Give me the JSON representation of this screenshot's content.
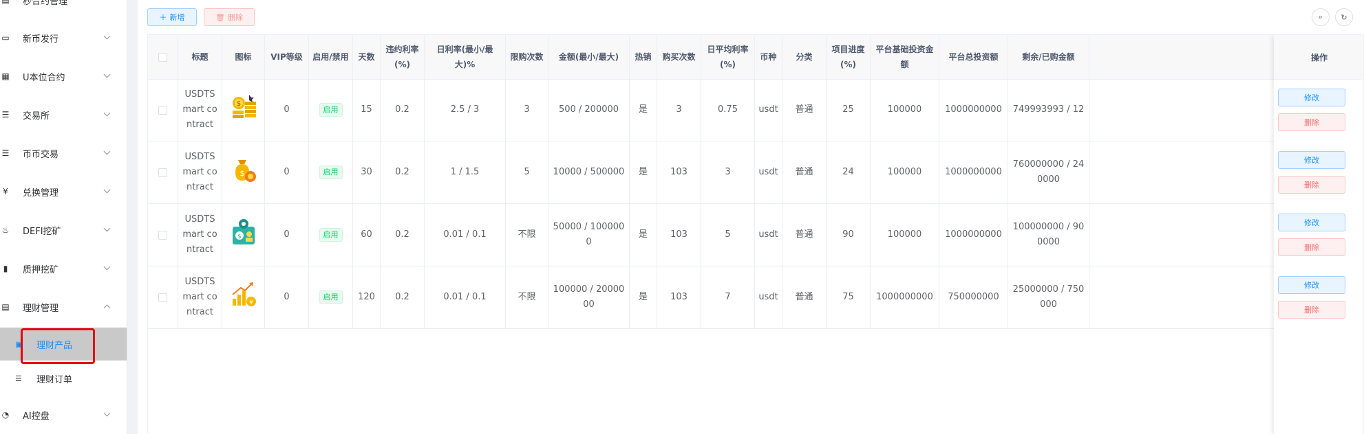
{
  "sidebar": {
    "items": [
      {
        "label": "秒合约管理",
        "icon": "box-icon",
        "glyph": "▤"
      },
      {
        "label": "新币发行",
        "icon": "card-icon",
        "glyph": "▭"
      },
      {
        "label": "U本位合约",
        "icon": "grid-icon",
        "glyph": "▦"
      },
      {
        "label": "交易所",
        "icon": "list-icon",
        "glyph": "☰"
      },
      {
        "label": "币币交易",
        "icon": "list-icon",
        "glyph": "☰"
      },
      {
        "label": "兑换管理",
        "icon": "yen-icon",
        "glyph": "¥"
      },
      {
        "label": "DEFI挖矿",
        "icon": "tool-icon",
        "glyph": "♨"
      },
      {
        "label": "质押挖矿",
        "icon": "bar-chart-icon",
        "glyph": "▮"
      },
      {
        "label": "理财管理",
        "icon": "document-icon",
        "glyph": "▤"
      }
    ],
    "sub_items": [
      {
        "label": "理财产品",
        "icon": "product-icon",
        "glyph": "▣"
      },
      {
        "label": "理财订单",
        "icon": "list-icon",
        "glyph": "☰"
      }
    ],
    "last_item": {
      "label": "AI控盘",
      "icon": "robot-icon",
      "glyph": "◔"
    }
  },
  "toolbar": {
    "add_label": "新增",
    "delete_label": "删除",
    "search_icon": "search-icon",
    "refresh_icon": "refresh-icon"
  },
  "table": {
    "headers": [
      "标题",
      "图标",
      "VIP等级",
      "启用/禁用",
      "天数",
      "违约利率(%)",
      "日利率(最小/最大)%",
      "限购次数",
      "金额(最小/最大)",
      "热销",
      "购买次数",
      "日平均利率(%)",
      "币种",
      "分类",
      "项目进度(%)",
      "平台基础投资金额",
      "平台总投资额",
      "剩余/已购金额"
    ],
    "op_header": "操作",
    "edit_label": "修改",
    "delete_label": "删除",
    "rows": [
      {
        "title": "USDTSmart contract",
        "icon": "coins-stack-icon",
        "vip": "0",
        "status": "启用",
        "days": "15",
        "penalty": "0.2",
        "daily_rate": "2.5 / 3",
        "limit": "3",
        "amount": "500 / 200000",
        "hot": "是",
        "buys": "3",
        "avg_rate": "0.75",
        "currency": "usdt",
        "category": "普通",
        "progress": "25",
        "base_invest": "100000",
        "total_invest": "1000000000",
        "remaining": "749993993 / 12"
      },
      {
        "title": "USDTSmart contract",
        "icon": "money-bag-icon",
        "vip": "0",
        "status": "启用",
        "days": "30",
        "penalty": "0.2",
        "daily_rate": "1 / 1.5",
        "limit": "5",
        "amount": "10000 / 500000",
        "hot": "是",
        "buys": "103",
        "avg_rate": "3",
        "currency": "usdt",
        "category": "普通",
        "progress": "24",
        "base_invest": "100000",
        "total_invest": "1000000000",
        "remaining": "760000000 / 240000"
      },
      {
        "title": "USDTSmart contract",
        "icon": "finance-gear-icon",
        "vip": "0",
        "status": "启用",
        "days": "60",
        "penalty": "0.2",
        "daily_rate": "0.01 / 0.1",
        "limit": "不限",
        "amount": "50000 / 1000000",
        "hot": "是",
        "buys": "103",
        "avg_rate": "5",
        "currency": "usdt",
        "category": "普通",
        "progress": "90",
        "base_invest": "100000",
        "total_invest": "1000000000",
        "remaining": "100000000 / 900000"
      },
      {
        "title": "USDTSmart contract",
        "icon": "growth-chart-icon",
        "vip": "0",
        "status": "启用",
        "days": "120",
        "penalty": "0.2",
        "daily_rate": "0.01 / 0.1",
        "limit": "不限",
        "amount": "100000 / 2000000",
        "hot": "是",
        "buys": "103",
        "avg_rate": "7",
        "currency": "usdt",
        "category": "普通",
        "progress": "75",
        "base_invest": "1000000000",
        "total_invest": "750000000",
        "remaining": "25000000 / 750000"
      }
    ]
  },
  "colors": {
    "accent": "#1890ff",
    "danger": "#f56c6c",
    "success": "#13ce66",
    "highlight": "#e60012"
  }
}
